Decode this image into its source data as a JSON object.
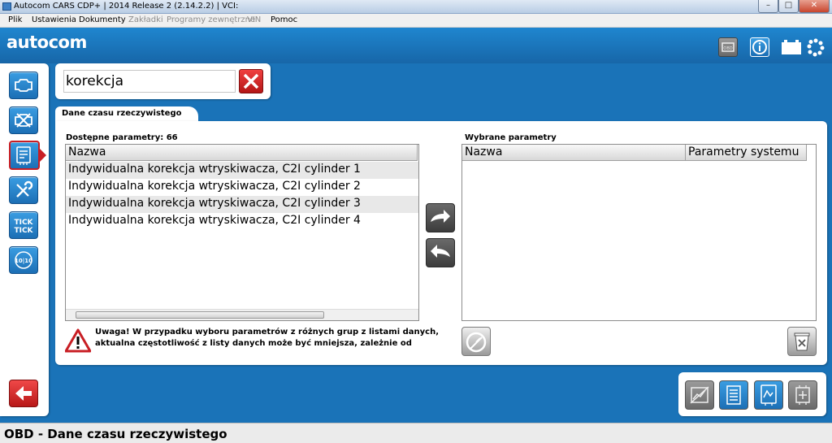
{
  "window": {
    "title": "Autocom CARS CDP+ | 2014 Release 2 (2.14.2.2) | VCI:",
    "min_glyph": "–",
    "max_glyph": "□",
    "close_glyph": "✕"
  },
  "menu": [
    {
      "label": "Plik",
      "enabled": true
    },
    {
      "label": "Ustawienia",
      "enabled": true
    },
    {
      "label": "Dokumenty",
      "enabled": true
    },
    {
      "label": "Zakładki",
      "enabled": false
    },
    {
      "label": "Programy zewnętrzne",
      "enabled": false
    },
    {
      "label": "VIN",
      "enabled": false
    },
    {
      "label": "Pomoc",
      "enabled": true
    }
  ],
  "header": {
    "logo": "autocom",
    "icons": [
      "obd-icon",
      "info-icon",
      "battery-icon",
      "settings-icon"
    ]
  },
  "sidebar": {
    "items": [
      {
        "name": "engine-icon",
        "active": false
      },
      {
        "name": "no-engine-icon",
        "active": false
      },
      {
        "name": "realtime-data-icon",
        "active": true
      },
      {
        "name": "tools-icon",
        "active": false
      },
      {
        "name": "tick-icon",
        "label": "TICK TICK",
        "active": false
      },
      {
        "name": "counter-icon",
        "label": "10|10",
        "active": false
      }
    ],
    "back_icon": "back-arrow-icon"
  },
  "search": {
    "value": "korekcja"
  },
  "tab": {
    "label": "Dane czasu rzeczywistego"
  },
  "available": {
    "title": "Dostępne parametry: 66",
    "column": "Nazwa",
    "rows": [
      "Indywidualna korekcja wtryskiwacza, C2I cylinder 1",
      "Indywidualna korekcja wtryskiwacza, C2I cylinder 2",
      "Indywidualna korekcja wtryskiwacza, C2I cylinder 3",
      "Indywidualna korekcja wtryskiwacza, C2I cylinder 4"
    ]
  },
  "selected": {
    "title": "Wybrane parametry",
    "columns": [
      "Nazwa",
      "Parametry systemu"
    ]
  },
  "warning": {
    "line1": "Uwaga!  W przypadku wyboru parametrów z różnych grup z listami danych,",
    "line2": "aktualna częstotliwość z listy danych może być mniejsza, zależnie od"
  },
  "bottom": {
    "icons": [
      "chart-icon",
      "list-icon",
      "graph-icon",
      "record-icon"
    ]
  },
  "status": {
    "text": "OBD - Dane czasu rzeczywistego"
  },
  "colors": {
    "background": "#1a73b8",
    "accent_red": "#c81e24",
    "button_blue": "#1c6fb5"
  }
}
